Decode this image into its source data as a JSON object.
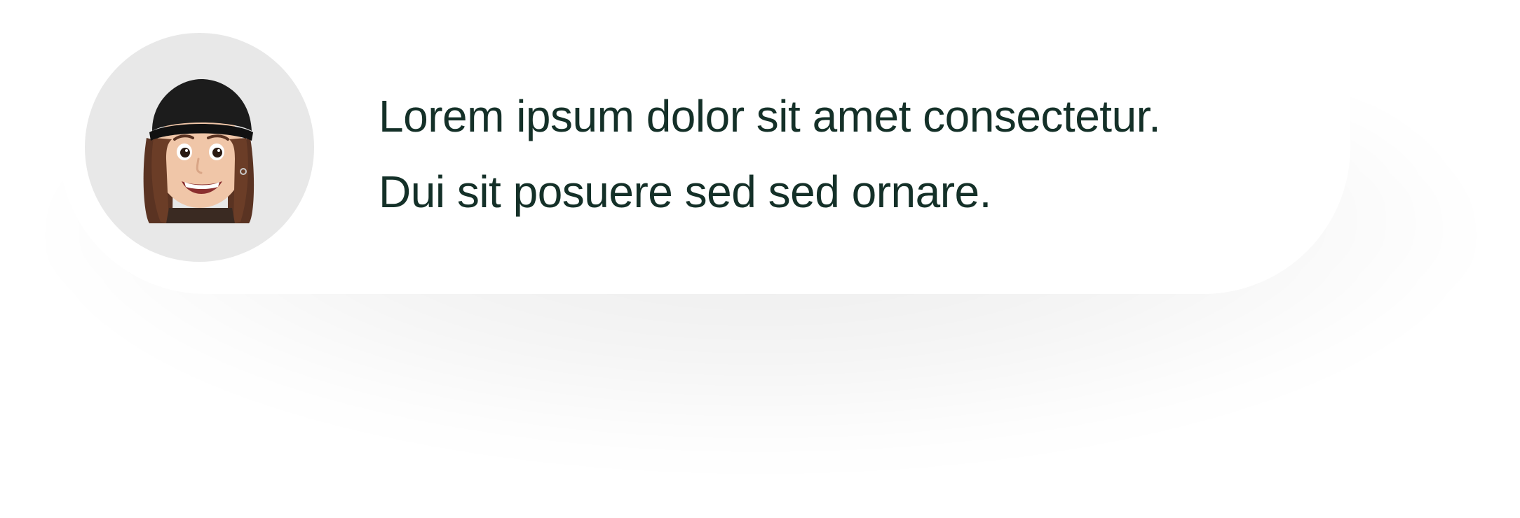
{
  "message": {
    "line1": "Lorem ipsum dolor sit amet consectetur.",
    "line2": "Dui sit posuere sed sed ornare."
  },
  "colors": {
    "text": "#143028",
    "avatar_bg": "#e8e8e8",
    "card_bg": "#ffffff"
  },
  "icons": {
    "avatar": "memoji-avatar-icon"
  }
}
